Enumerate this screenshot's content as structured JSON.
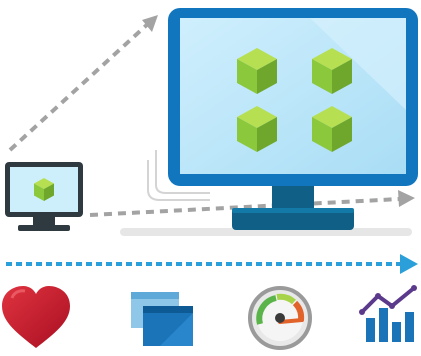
{
  "illustration": {
    "theme": "scale-up-from-small-to-large-monitor",
    "colors": {
      "monitor_frame": "#1276BF",
      "monitor_screen": "#BFE8FA",
      "monitor_base": "#0F5F86",
      "small_monitor_frame": "#2F3A40",
      "cube_green": "#8CC83C",
      "cube_light": "#B6E052",
      "cube_dark": "#6EA72C",
      "arrow_gray": "#A0A0A0",
      "arrow_blue": "#2B9FD9",
      "heart_red": "#C8102E",
      "chart_blue": "#1C74B8",
      "chart_purple": "#5B3A8C",
      "gauge_green": "#5BB44A",
      "gauge_orange": "#E2632A"
    },
    "icons": [
      "heart-icon",
      "windows-icon",
      "gauge-icon",
      "bar-chart-icon"
    ]
  }
}
